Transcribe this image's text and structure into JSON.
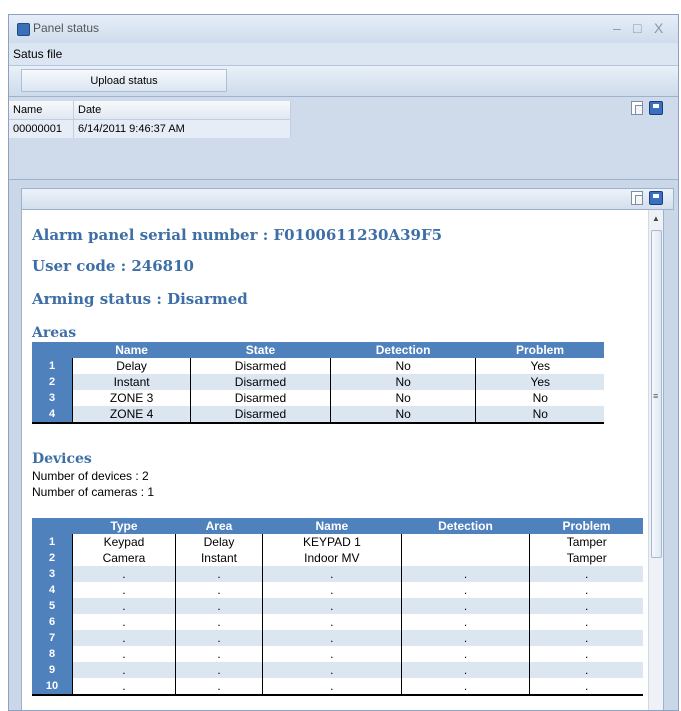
{
  "window": {
    "title": "Panel status",
    "minimize_glyph": "–",
    "maximize_glyph": "□",
    "close_glyph": "X"
  },
  "menu": {
    "items": [
      "Satus file"
    ]
  },
  "toolbar": {
    "upload_label": "Upload status"
  },
  "status_files": {
    "columns": [
      "Name",
      "Date"
    ],
    "rows": [
      [
        "00000001",
        "6/14/2011 9:46:37 AM"
      ]
    ]
  },
  "report": {
    "serial_label": "Alarm panel serial number : F0100611230A39F5",
    "user_code_label": "User code : 246810",
    "arming_status_label": "Arming status : Disarmed",
    "areas": {
      "heading": "Areas",
      "columns": [
        "Name",
        "State",
        "Detection",
        "Problem"
      ],
      "rows": [
        [
          "1",
          "Delay",
          "Disarmed",
          "No",
          "Yes"
        ],
        [
          "2",
          "Instant",
          "Disarmed",
          "No",
          "Yes"
        ],
        [
          "3",
          "ZONE 3",
          "Disarmed",
          "No",
          "No"
        ],
        [
          "4",
          "ZONE 4",
          "Disarmed",
          "No",
          "No"
        ]
      ]
    },
    "devices": {
      "heading": "Devices",
      "count_label": "Number of devices : 2",
      "cameras_label": "Number of cameras : 1",
      "columns": [
        "Type",
        "Area",
        "Name",
        "Detection",
        "Problem"
      ],
      "rows": [
        [
          "1",
          "Keypad",
          "Delay",
          "KEYPAD 1",
          "",
          "Tamper"
        ],
        [
          "2",
          "Camera",
          "Instant",
          "Indoor MV",
          "",
          "Tamper"
        ],
        [
          "3",
          ".",
          ".",
          ".",
          ".",
          "."
        ],
        [
          "4",
          ".",
          ".",
          ".",
          ".",
          "."
        ],
        [
          "5",
          ".",
          ".",
          ".",
          ".",
          "."
        ],
        [
          "6",
          ".",
          ".",
          ".",
          ".",
          "."
        ],
        [
          "7",
          ".",
          ".",
          ".",
          ".",
          "."
        ],
        [
          "8",
          ".",
          ".",
          ".",
          ".",
          "."
        ],
        [
          "9",
          ".",
          ".",
          ".",
          ".",
          "."
        ],
        [
          "10",
          ".",
          ".",
          ".",
          ".",
          "."
        ]
      ]
    }
  },
  "icons": [
    "app-icon",
    "copy-icon",
    "save-icon",
    "scroll-up-icon",
    "scroll-grip-icon"
  ]
}
